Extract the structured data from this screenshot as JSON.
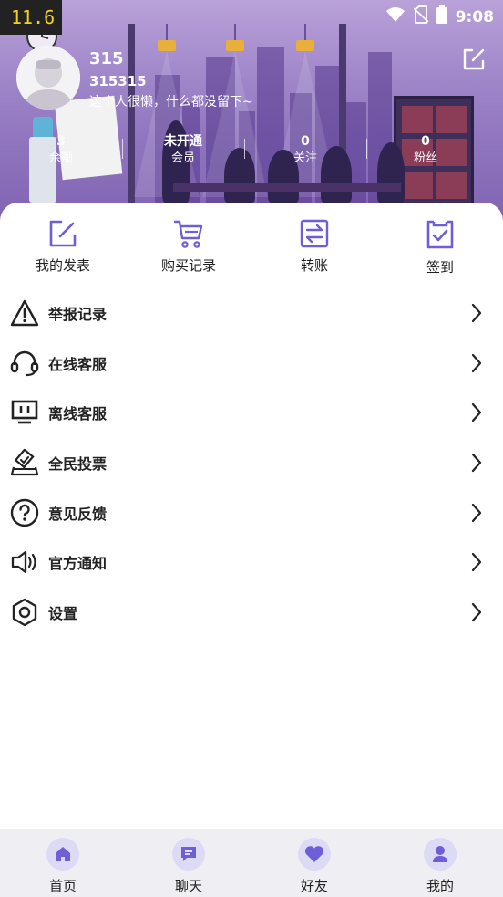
{
  "status_bar": {
    "badge": "11.6",
    "time": "9:08",
    "icons": [
      "wifi-icon",
      "no-sim-icon",
      "battery-icon"
    ]
  },
  "profile": {
    "name": "315",
    "user_id": "315315",
    "signature": "这个人很懒，什么都没留下~"
  },
  "stats": [
    {
      "value": "3",
      "label": "余额"
    },
    {
      "value": "未开通",
      "label": "会员"
    },
    {
      "value": "0",
      "label": "关注"
    },
    {
      "value": "0",
      "label": "粉丝"
    }
  ],
  "quick_actions": [
    {
      "label": "我的发表",
      "icon": "edit-icon"
    },
    {
      "label": "购买记录",
      "icon": "cart-icon"
    },
    {
      "label": "转账",
      "icon": "transfer-icon"
    },
    {
      "label": "签到",
      "icon": "checkin-icon"
    }
  ],
  "menu": [
    {
      "label": "举报记录",
      "icon": "warning-icon"
    },
    {
      "label": "在线客服",
      "icon": "headset-icon"
    },
    {
      "label": "离线客服",
      "icon": "monitor-icon"
    },
    {
      "label": "全民投票",
      "icon": "vote-icon"
    },
    {
      "label": "意见反馈",
      "icon": "question-icon"
    },
    {
      "label": "官方通知",
      "icon": "speaker-icon"
    },
    {
      "label": "设置",
      "icon": "settings-icon"
    }
  ],
  "tabs": [
    {
      "label": "首页",
      "icon": "home-icon"
    },
    {
      "label": "聊天",
      "icon": "chat-icon"
    },
    {
      "label": "好友",
      "icon": "heart-icon"
    },
    {
      "label": "我的",
      "icon": "user-icon"
    }
  ],
  "colors": {
    "accent": "#6f5fd6",
    "hero_top": "#b9a1d9",
    "hero_bottom": "#7f63b2",
    "tabbar_bg": "#efeef2"
  }
}
